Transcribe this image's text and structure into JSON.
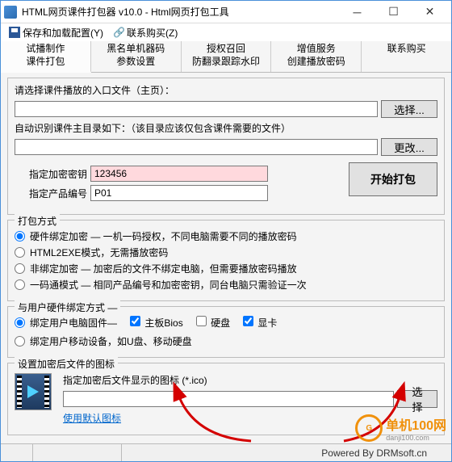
{
  "window": {
    "title": "HTML网页课件打包器 v10.0 - Html网页打包工具"
  },
  "menu": {
    "save_load": "保存和加载配置(Y)",
    "contact": "联系购买(Z)"
  },
  "tabs": [
    {
      "l1": "试播制作",
      "l2": "课件打包"
    },
    {
      "l1": "黑名单机器码",
      "l2": "参数设置"
    },
    {
      "l1": "授权召回",
      "l2": "防翻录跟踪水印"
    },
    {
      "l1": "增值服务",
      "l2": "创建播放密码"
    },
    {
      "l1": "联系购买",
      "l2": ""
    }
  ],
  "entry": {
    "label": "请选择课件播放的入口文件（主页）：",
    "value": "",
    "select_btn": "选择..."
  },
  "auto_dir": {
    "label": "自动识别课件主目录如下：（该目录应该仅包含课件需要的文件）",
    "value": "",
    "change_btn": "更改..."
  },
  "key": {
    "label": "指定加密密钥",
    "value": "123456"
  },
  "product": {
    "label": "指定产品编号",
    "value": "P01"
  },
  "start_btn": "开始打包",
  "pack_mode": {
    "legend": "打包方式",
    "opts": [
      "硬件绑定加密 — 一机一码授权，不同电脑需要不同的播放密码",
      "HTML2EXE模式，无需播放密码",
      "非绑定加密 — 加密后的文件不绑定电脑，但需要播放密码播放",
      "一码通模式 — 相同产品编号和加密密钥，同台电脑只需验证一次"
    ]
  },
  "hw_bind": {
    "legend": "与用户硬件绑定方式 —",
    "opt1": "绑定用户电脑固件—",
    "c1": "主板Bios",
    "c2": "硬盘",
    "c3": "显卡",
    "opt2": "绑定用户移动设备，如U盘、移动硬盘"
  },
  "icon_set": {
    "legend": "设置加密后文件的图标",
    "label": "指定加密后文件显示的图标 (*.ico)",
    "value": "",
    "btn": "选择",
    "default_link": "使用默认图标"
  },
  "status": {
    "powered": "Powered By DRMsoft.cn"
  },
  "watermark": {
    "brand": "单机100网",
    "url": "danji100.com"
  }
}
